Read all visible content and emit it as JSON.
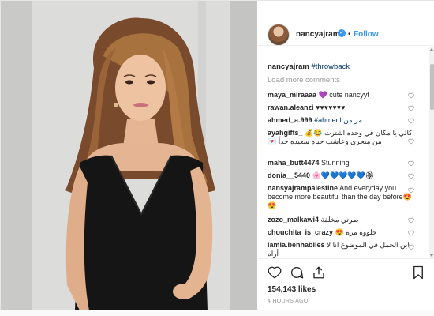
{
  "header": {
    "username": "nancyajram",
    "separator": "•",
    "follow_label": "Follow"
  },
  "caption": {
    "username": "nancyajram",
    "hashtag": "#throwback"
  },
  "load_more_label": "Load more comments",
  "comments": [
    {
      "user": "maya_miraaaa",
      "text": "💜 cute nancyyt"
    },
    {
      "user": "rawan.aleanzi",
      "text": "♥♥♥♥♥♥♥"
    },
    {
      "user": "ahmed_a.999",
      "text": "#ahmedl مر من"
    },
    {
      "user": "ayahgifts_",
      "text": "كالي يا مكان في وحده اشترت 😂💰من متجري وعاشت حياه سعيده جداً 💌"
    },
    {
      "user": "maha_butt4474",
      "text": "Stunning"
    },
    {
      "user": "donia__5440",
      "text": "🌸💙💙💙💙💙🏵"
    },
    {
      "user": "nansyajrampalestine",
      "text": "And everyday you become more beautiful than the day before😍😍"
    },
    {
      "user": "zozo_malkawi4",
      "text": "صرتي مخلفة"
    },
    {
      "user": "chouchita_is_crazy",
      "text": "حلووة مرة 😍"
    },
    {
      "user": "lamia.benhabiles",
      "text": "اين الحمل في الموضوع انا لا أراه"
    }
  ],
  "likes_label": "154,143 likes",
  "time_ago": "4 HOURS AGO",
  "icons": {
    "verified": "✓"
  },
  "colors": {
    "link_blue": "#3897f0",
    "hashtag_blue": "#003569",
    "muted": "#999999"
  }
}
